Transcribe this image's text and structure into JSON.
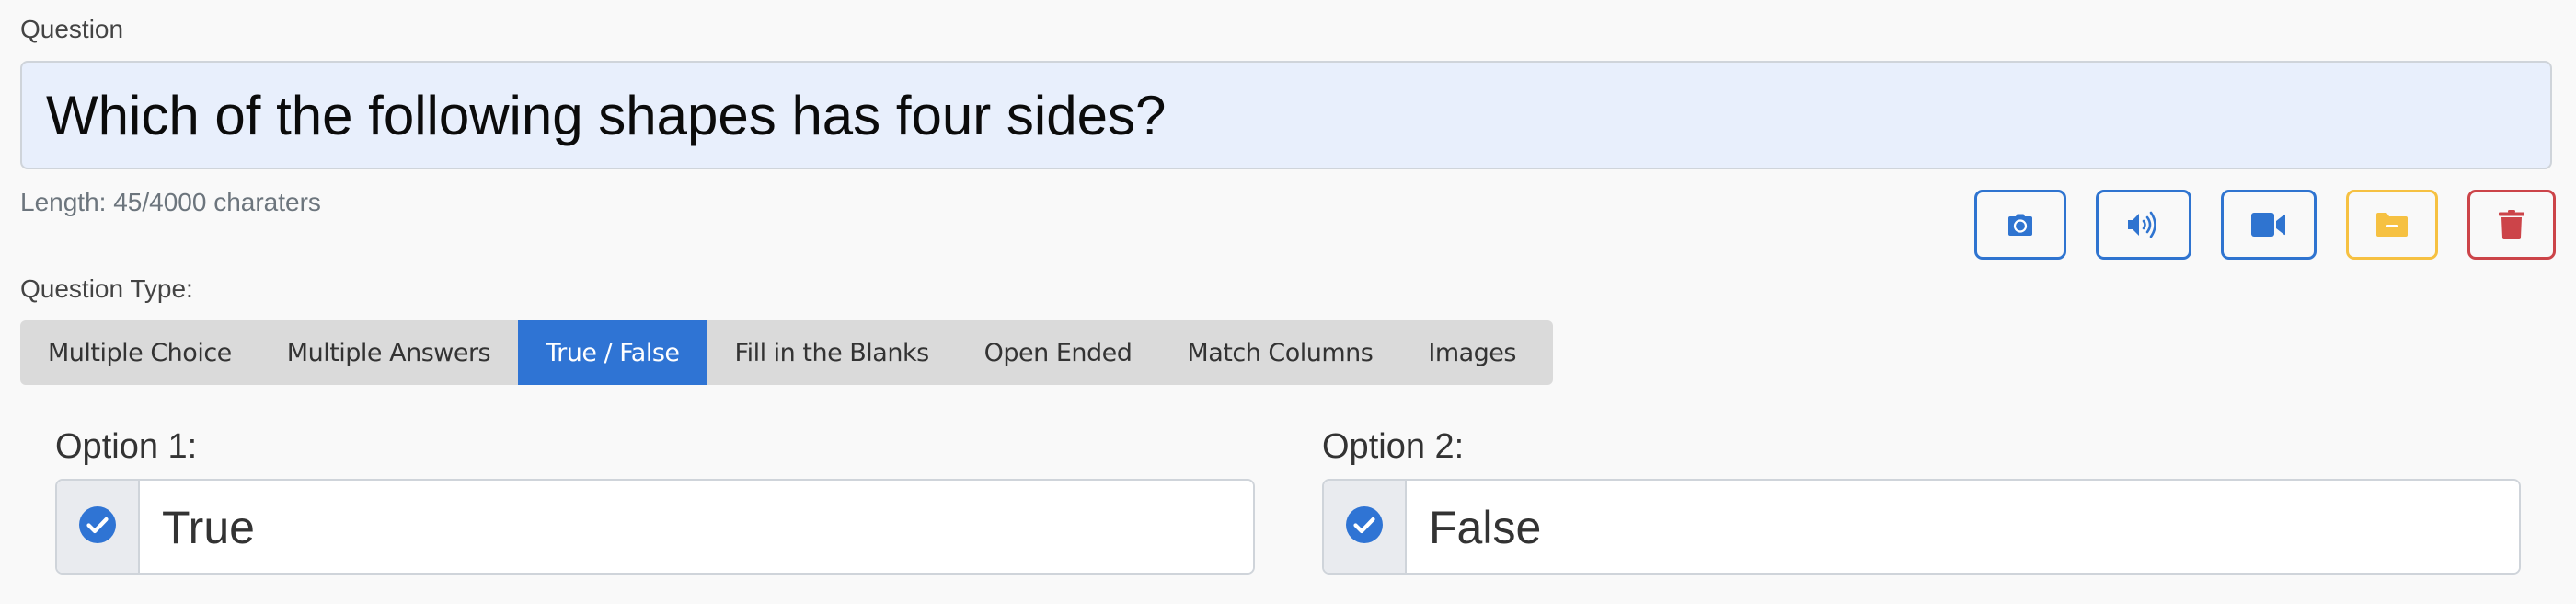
{
  "question": {
    "label": "Question",
    "value": "Which of the following shapes has four sides?",
    "length_text": "Length: 45/4000 charaters"
  },
  "media_buttons": [
    {
      "name": "camera",
      "icon": "camera-icon",
      "color": "#2f74d0"
    },
    {
      "name": "audio",
      "icon": "volume-icon",
      "color": "#2f74d0"
    },
    {
      "name": "video",
      "icon": "video-icon",
      "color": "#2f74d0"
    },
    {
      "name": "folder",
      "icon": "folder-minus-icon",
      "color": "#f6c142"
    },
    {
      "name": "delete",
      "icon": "trash-icon",
      "color": "#cc4449"
    }
  ],
  "question_type": {
    "label": "Question Type:",
    "tabs": [
      {
        "label": "Multiple Choice",
        "active": false
      },
      {
        "label": "Multiple Answers",
        "active": false
      },
      {
        "label": "True / False",
        "active": true
      },
      {
        "label": "Fill in the Blanks",
        "active": false
      },
      {
        "label": "Open Ended",
        "active": false
      },
      {
        "label": "Match Columns",
        "active": false
      },
      {
        "label": "Images",
        "active": false
      }
    ],
    "active_color": "#2f74d4"
  },
  "options": [
    {
      "label": "Option 1:",
      "value": "True",
      "checked": true
    },
    {
      "label": "Option 2:",
      "value": "False",
      "checked": true
    }
  ],
  "colors": {
    "accent": "#2f74d4",
    "warning": "#f6c142",
    "danger": "#cc4449",
    "question_bg": "#e8effc"
  }
}
